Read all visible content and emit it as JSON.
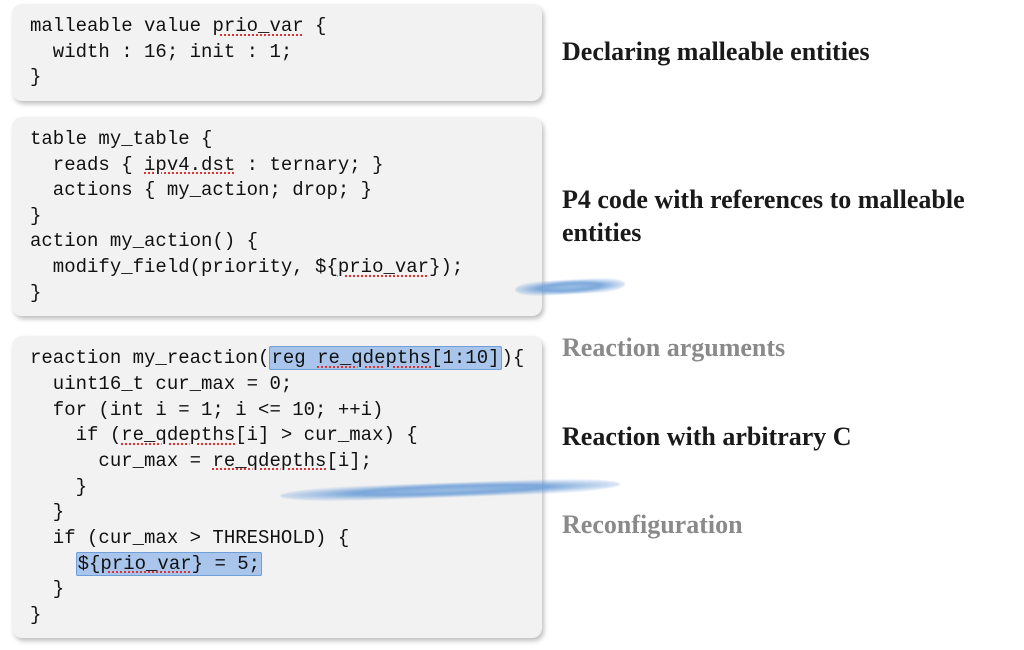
{
  "block1": {
    "code_pre": "malleable value ",
    "code_under": "prio_var",
    "code_post1": " {\n  width : 16; init : 1;\n}",
    "annot": "Declaring malleable entities"
  },
  "block2": {
    "l1": "table my_table {",
    "l2a": "  reads { ",
    "l2u": "ipv4.dst",
    "l2b": " : ternary; }",
    "l3": "  actions { my_action; drop; }",
    "l4": "}",
    "l5": "action my_action() {",
    "l6a": "  modify_field(priority, ${",
    "l6u": "prio_var",
    "l6b": "});",
    "l7": "}",
    "annot": "P4 code with references to malleable entities"
  },
  "block3": {
    "l1a": "reaction my_reaction(",
    "l1h_a": "reg ",
    "l1h_u": "re_qdepths",
    "l1h_b": "[1:10]",
    "l1c": "){",
    "l2": "  uint16_t cur_max = 0;",
    "l3": "  for (int i = 1; i <= 10; ++i)",
    "l4a": "    if (",
    "l4u": "re_qdepths",
    "l4b": "[i] > cur_max) {",
    "l5a": "      cur_max = ",
    "l5u": "re_qdepths",
    "l5b": "[i];",
    "l6": "    }",
    "l7": "  }",
    "l8": "  if (cur_max > THRESHOLD) {",
    "l9a": "    ",
    "l9h_a": "${",
    "l9h_u": "prio_var",
    "l9h_b": "} = 5;",
    "l10": "  }",
    "l11": "}",
    "annot_top": "Reaction arguments",
    "annot_mid": "Reaction with arbitrary C",
    "annot_bot": "Reconfiguration"
  }
}
